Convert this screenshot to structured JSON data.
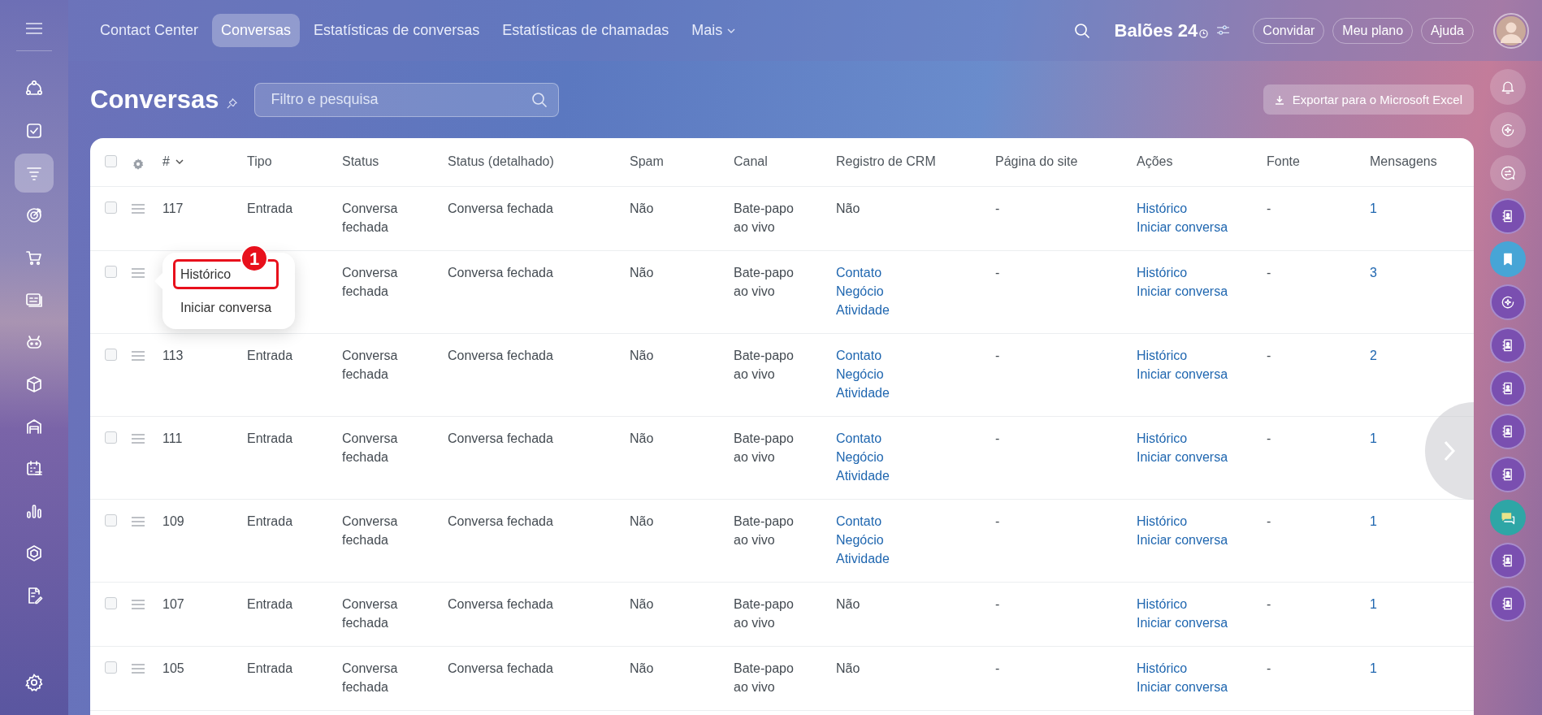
{
  "sidebar": {
    "items": [
      {
        "kind": "nodes",
        "selected": false
      },
      {
        "kind": "check",
        "selected": false
      },
      {
        "kind": "filter",
        "selected": true
      },
      {
        "kind": "target",
        "selected": false
      },
      {
        "kind": "cart",
        "selected": false
      },
      {
        "kind": "card",
        "selected": false
      },
      {
        "kind": "robot",
        "selected": false
      },
      {
        "kind": "cube",
        "selected": false
      },
      {
        "kind": "warehouse",
        "selected": false
      },
      {
        "kind": "calendar",
        "selected": false
      },
      {
        "kind": "chart",
        "selected": false
      },
      {
        "kind": "hexagon",
        "selected": false
      },
      {
        "kind": "document",
        "selected": false
      }
    ]
  },
  "nav": {
    "tabs": [
      {
        "label": "Contact Center",
        "selected": false
      },
      {
        "label": "Conversas",
        "selected": true
      },
      {
        "label": "Estatísticas de conversas",
        "selected": false
      },
      {
        "label": "Estatísticas de chamadas",
        "selected": false
      }
    ],
    "more": "Mais"
  },
  "header": {
    "logo": "Balões 24",
    "buttons": [
      "Convidar",
      "Meu plano",
      "Ajuda"
    ]
  },
  "page": {
    "title": "Conversas",
    "search": {
      "placeholder": "Filtro e pesquisa"
    },
    "export": "Exportar para o Microsoft Excel"
  },
  "table": {
    "all_checked": false,
    "sort_label": "#",
    "columns": [
      "Tipo",
      "Status",
      "Status (detalhado)",
      "Spam",
      "Canal",
      "Registro de CRM",
      "Página do site",
      "Ações",
      "Fonte",
      "Mensagens"
    ],
    "rows": [
      {
        "checked": false,
        "id": "117",
        "tipo": "Entrada",
        "status": "Conversa fechada",
        "status_detail": "Conversa fechada",
        "spam": "Não",
        "canal": "Bate-papo ao vivo",
        "crm": {
          "kind": "text",
          "text": "Não"
        },
        "pagina": "-",
        "acoes": [
          "Histórico",
          "Iniciar conversa"
        ],
        "fonte": "-",
        "mensagens": "1"
      },
      {
        "checked": false,
        "status": "Conversa fechada",
        "status_detail": "Conversa fechada",
        "spam": "Não",
        "canal": "Bate-papo ao vivo",
        "crm": {
          "kind": "links",
          "links": [
            "Contato",
            "Negócio",
            "Atividade"
          ]
        },
        "pagina": "-",
        "acoes": [
          "Histórico",
          "Iniciar conversa"
        ],
        "fonte": "-",
        "mensagens": "3",
        "menu": {
          "items": [
            {
              "label": "Histórico",
              "highlighted": true
            },
            {
              "label": "Iniciar conversa",
              "highlighted": false
            }
          ],
          "badge": "1"
        }
      },
      {
        "checked": false,
        "id": "113",
        "tipo": "Entrada",
        "status": "Conversa fechada",
        "status_detail": "Conversa fechada",
        "spam": "Não",
        "canal": "Bate-papo ao vivo",
        "crm": {
          "kind": "links",
          "links": [
            "Contato",
            "Negócio",
            "Atividade"
          ]
        },
        "pagina": "-",
        "acoes": [
          "Histórico",
          "Iniciar conversa"
        ],
        "fonte": "-",
        "mensagens": "2"
      },
      {
        "checked": false,
        "id": "111",
        "tipo": "Entrada",
        "status": "Conversa fechada",
        "status_detail": "Conversa fechada",
        "spam": "Não",
        "canal": "Bate-papo ao vivo",
        "crm": {
          "kind": "links",
          "links": [
            "Contato",
            "Negócio",
            "Atividade"
          ]
        },
        "pagina": "-",
        "acoes": [
          "Histórico",
          "Iniciar conversa"
        ],
        "fonte": "-",
        "mensagens": "1"
      },
      {
        "checked": false,
        "id": "109",
        "tipo": "Entrada",
        "status": "Conversa fechada",
        "status_detail": "Conversa fechada",
        "spam": "Não",
        "canal": "Bate-papo ao vivo",
        "crm": {
          "kind": "links",
          "links": [
            "Contato",
            "Negócio",
            "Atividade"
          ]
        },
        "pagina": "-",
        "acoes": [
          "Histórico",
          "Iniciar conversa"
        ],
        "fonte": "-",
        "mensagens": "1"
      },
      {
        "checked": false,
        "id": "107",
        "tipo": "Entrada",
        "status": "Conversa fechada",
        "status_detail": "Conversa fechada",
        "spam": "Não",
        "canal": "Bate-papo ao vivo",
        "crm": {
          "kind": "text",
          "text": "Não"
        },
        "pagina": "-",
        "acoes": [
          "Histórico",
          "Iniciar conversa"
        ],
        "fonte": "-",
        "mensagens": "1"
      },
      {
        "checked": false,
        "id": "105",
        "tipo": "Entrada",
        "status": "Conversa fechada",
        "status_detail": "Conversa fechada",
        "spam": "Não",
        "canal": "Bate-papo ao vivo",
        "crm": {
          "kind": "text",
          "text": "Não"
        },
        "pagina": "-",
        "acoes": [
          "Histórico",
          "Iniciar conversa"
        ],
        "fonte": "-",
        "mensagens": "1"
      }
    ]
  },
  "right_rail": {
    "items": [
      {
        "kind": "bell"
      },
      {
        "kind": "sparkle"
      },
      {
        "kind": "swap"
      },
      {
        "kind": "contact"
      },
      {
        "kind": "bookmark"
      },
      {
        "kind": "assistant"
      },
      {
        "kind": "contact"
      },
      {
        "kind": "contact"
      },
      {
        "kind": "contact"
      },
      {
        "kind": "contact"
      },
      {
        "kind": "chat"
      },
      {
        "kind": "contact"
      },
      {
        "kind": "contact"
      }
    ]
  }
}
